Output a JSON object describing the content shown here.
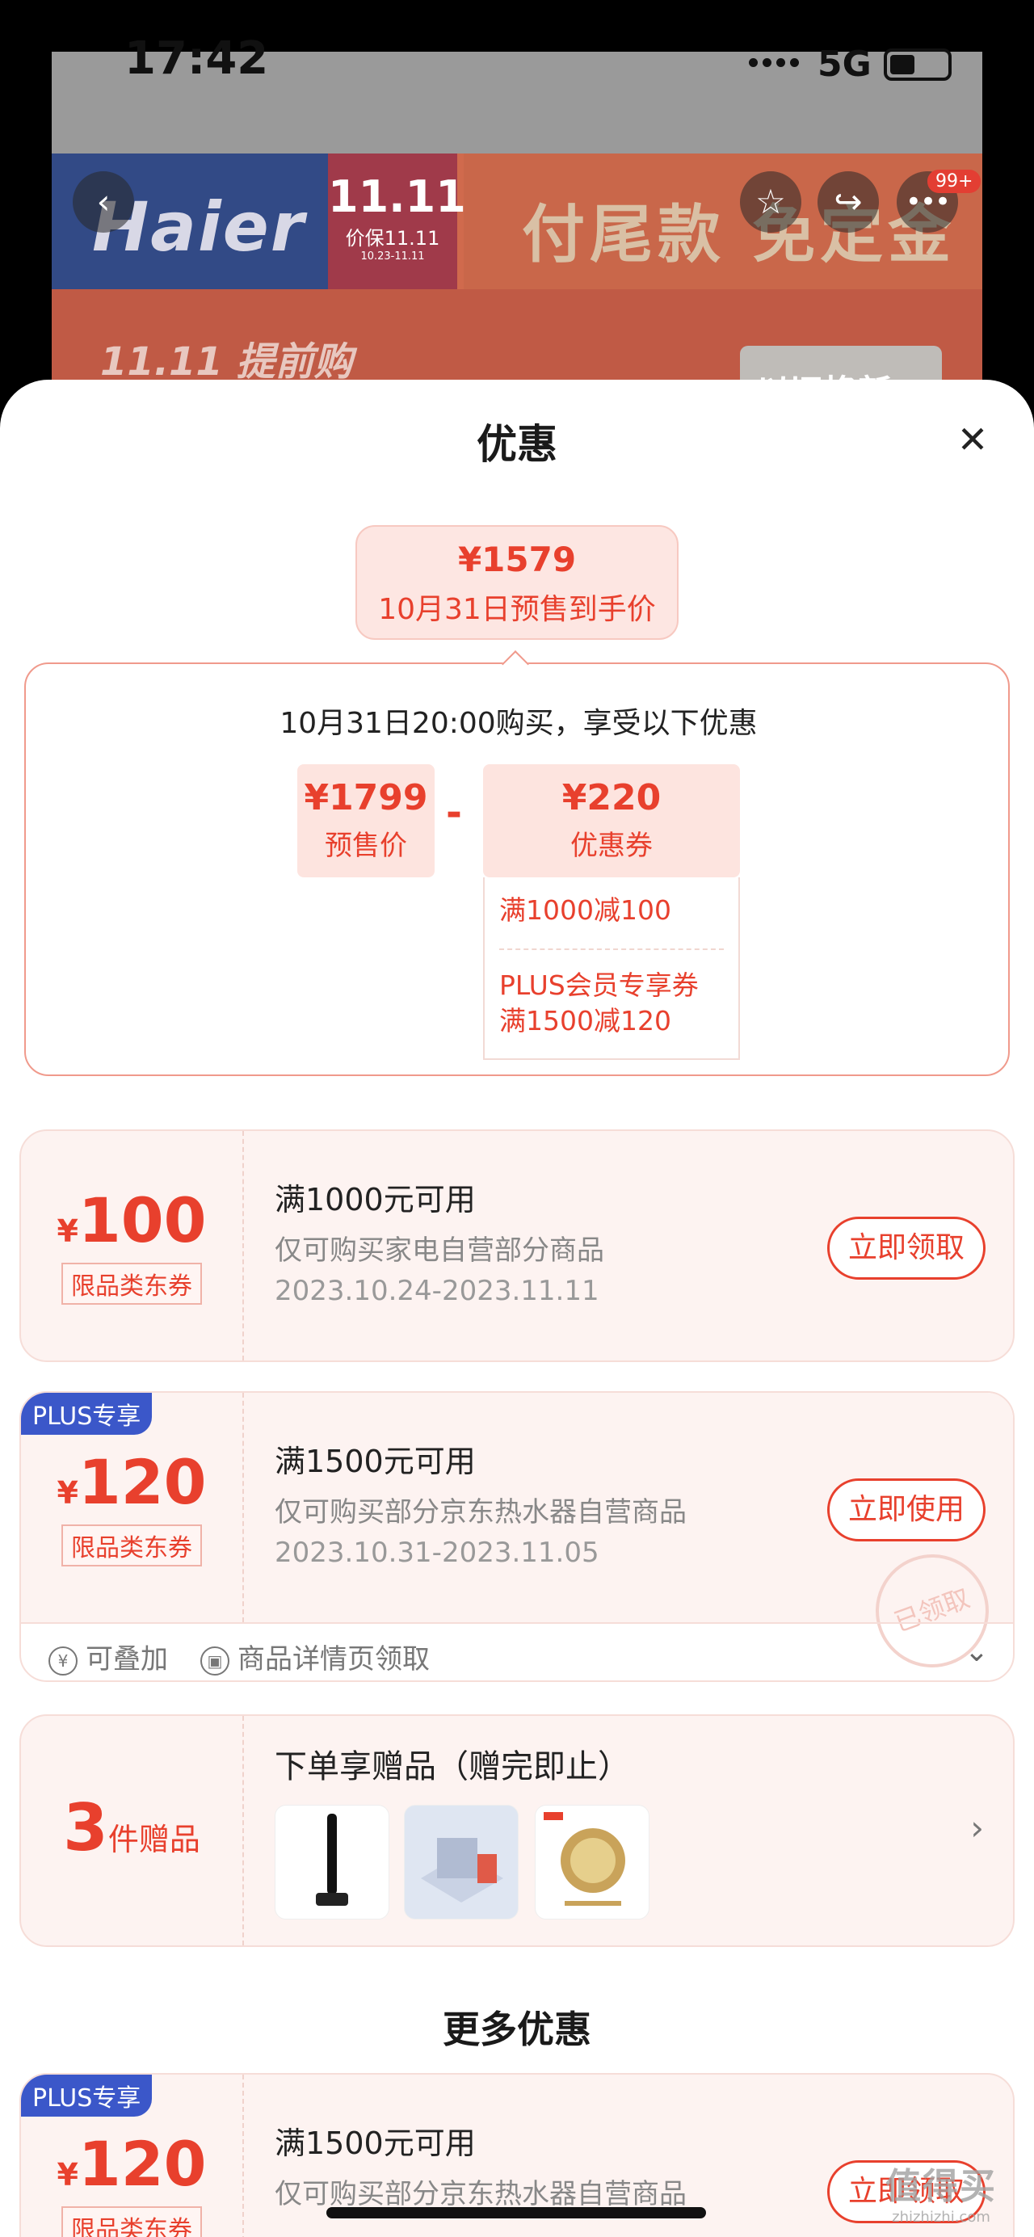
{
  "status_bar": {
    "time": "17:42",
    "network": "5G"
  },
  "banner": {
    "brand": "Haier",
    "promo_big": "11.11",
    "promo_small": "价保11.11",
    "promo_dates": "10.23-11.11",
    "headline": "付尾款 免定金",
    "subline": "11.11 提前购",
    "tradein": "以旧换新",
    "more_badge": "99+"
  },
  "sheet": {
    "title": "优惠",
    "price_bubble": {
      "amount": "¥1579",
      "label": "10月31日预售到手价"
    },
    "preorder": {
      "heading": "10月31日20:00购买，享受以下优惠",
      "presale_value": "¥1799",
      "presale_label": "预售价",
      "minus": "-",
      "coupon_value": "¥220",
      "coupon_label": "优惠券",
      "coupon_line1": "满1000减100",
      "coupon_line2": "PLUS会员专享券",
      "coupon_line3": "满1500减120"
    }
  },
  "coupons": [
    {
      "yen": "¥",
      "amount": "100",
      "tag": "限品类东券",
      "title": "满1000元可用",
      "desc": "仅可购买家电自营部分商品",
      "date": "2023.10.24-2023.11.11",
      "button": "立即领取"
    },
    {
      "plus": "PLUS专享",
      "yen": "¥",
      "amount": "120",
      "tag": "限品类东券",
      "title": "满1500元可用",
      "desc": "仅可购买部分京东热水器自营商品",
      "date": "2023.10.31-2023.11.05",
      "button": "立即使用",
      "stamp": "已领取",
      "footer_stack": "可叠加",
      "footer_detail": "商品详情页领取"
    }
  ],
  "gifts": {
    "count": "3",
    "count_label": "件赠品",
    "title": "下单享赠品（赠完即止）"
  },
  "more": {
    "title": "更多优惠",
    "coupon": {
      "plus": "PLUS专享",
      "yen": "¥",
      "amount": "120",
      "tag": "限品类东券",
      "title": "满1500元可用",
      "desc": "仅可购买部分京东热水器自营商品",
      "button": "立即领取"
    }
  },
  "watermark": {
    "main": "值得买",
    "sub": "zhizhizhi.com"
  },
  "colors": {
    "accent": "#e8402d",
    "plus": "#3b57c9"
  }
}
